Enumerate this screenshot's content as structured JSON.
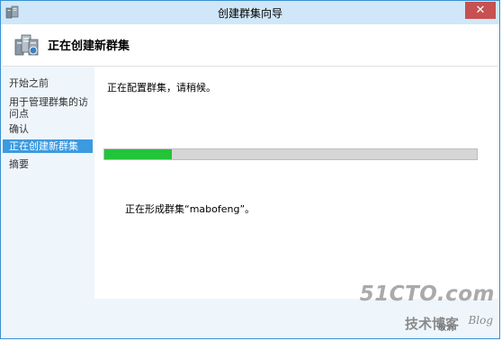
{
  "window": {
    "title": "创建群集向导",
    "close_icon": "close-icon",
    "app_icon": "cluster-wizard-icon"
  },
  "header": {
    "title": "正在创建新群集",
    "icon": "cluster-servers-icon"
  },
  "sidebar": {
    "items": [
      {
        "label": "开始之前",
        "active": false
      },
      {
        "label": "用于管理群集的访问点",
        "active": false
      },
      {
        "label": "确认",
        "active": false
      },
      {
        "label": "正在创建新群集",
        "active": true
      },
      {
        "label": "摘要",
        "active": false
      }
    ]
  },
  "main": {
    "status": "正在配置群集，请稍候。",
    "progress": 0.18,
    "sub_status": "正在形成群集“mabofeng”。"
  },
  "footer": {
    "button_hint": "取消"
  },
  "watermark": {
    "brand": "51CTO.com",
    "subtitle": "技术博客",
    "blog": "Blog"
  },
  "colors": {
    "titlebar": "#cfe7f8",
    "active_nav": "#3c9ae0",
    "progress_fill": "#23c33a",
    "close_button": "#c75050"
  }
}
